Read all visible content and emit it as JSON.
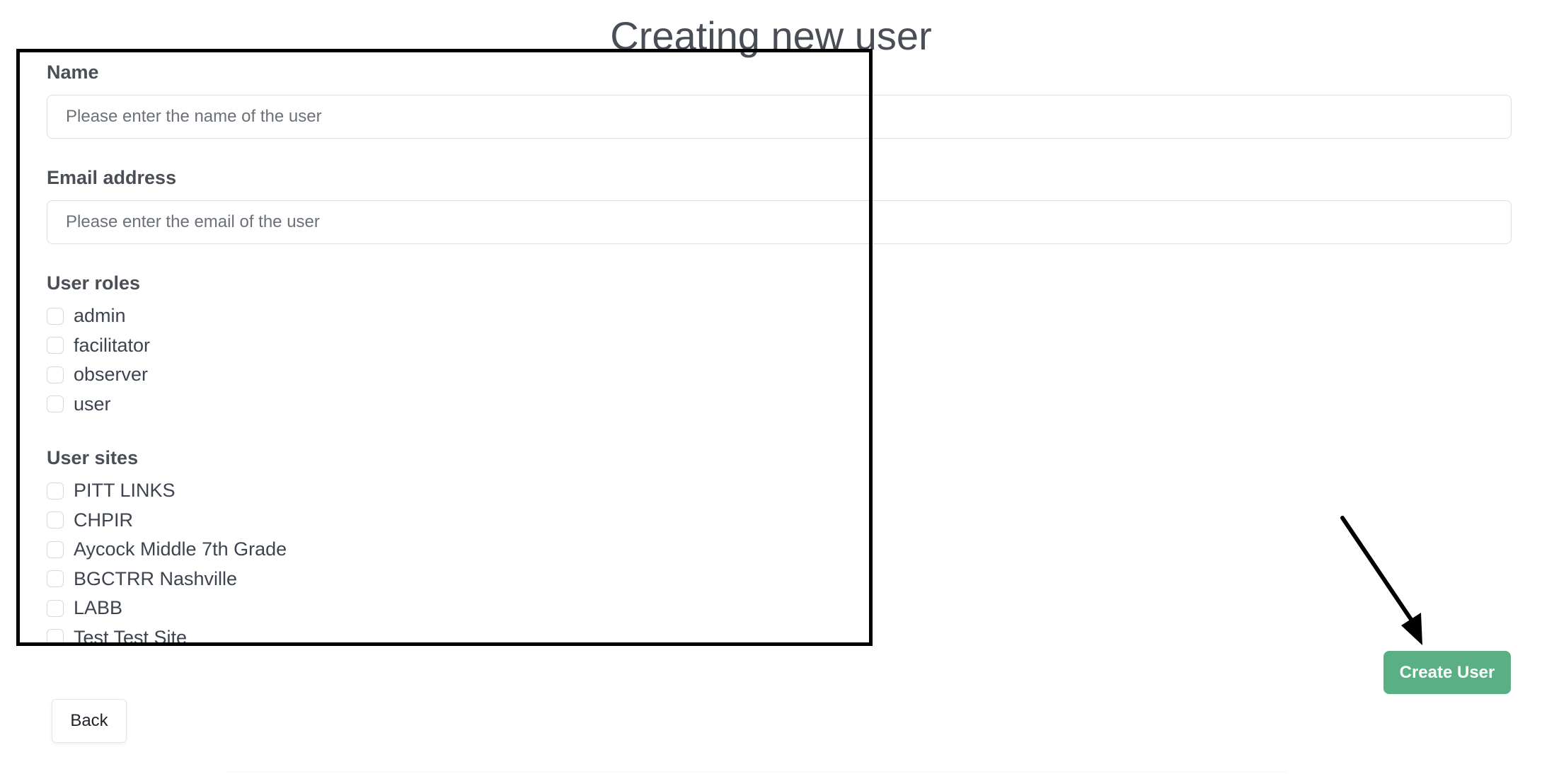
{
  "page": {
    "title": "Creating new user"
  },
  "form": {
    "name": {
      "label": "Name",
      "value": "",
      "placeholder": "Please enter the name of the user"
    },
    "email": {
      "label": "Email address",
      "value": "",
      "placeholder": "Please enter the email of the user"
    },
    "roles": {
      "label": "User roles",
      "options": [
        {
          "label": "admin",
          "checked": false
        },
        {
          "label": "facilitator",
          "checked": false
        },
        {
          "label": "observer",
          "checked": false
        },
        {
          "label": "user",
          "checked": false
        }
      ]
    },
    "sites": {
      "label": "User sites",
      "options": [
        {
          "label": "PITT LINKS",
          "checked": false
        },
        {
          "label": "CHPIR",
          "checked": false
        },
        {
          "label": "Aycock Middle 7th Grade",
          "checked": false
        },
        {
          "label": "BGCTRR Nashville",
          "checked": false
        },
        {
          "label": "LABB",
          "checked": false
        },
        {
          "label": "Test Test Site",
          "checked": false
        }
      ]
    }
  },
  "actions": {
    "create_label": "Create User",
    "back_label": "Back"
  },
  "colors": {
    "primary_button": "#5aaf85",
    "annotation": "#000000"
  }
}
